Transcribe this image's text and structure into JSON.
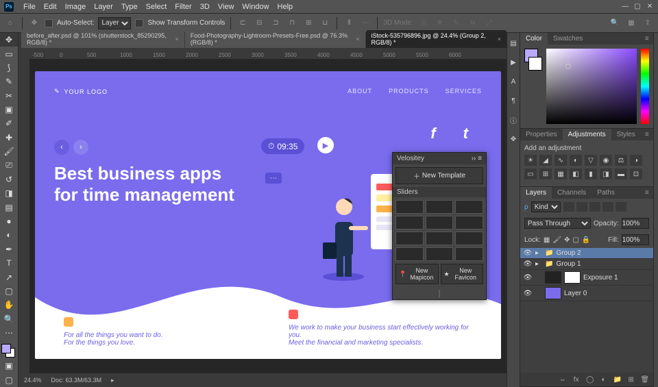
{
  "app": {
    "logo": "Ps"
  },
  "menu": [
    "File",
    "Edit",
    "Image",
    "Layer",
    "Type",
    "Select",
    "Filter",
    "3D",
    "View",
    "Window",
    "Help"
  ],
  "options": {
    "auto_select": "Auto-Select:",
    "auto_select_value": "Layer",
    "show_transform": "Show Transform Controls",
    "mode_label": "3D Mode:"
  },
  "tabs": [
    {
      "label": "before_after.psd @ 101% (shutterstock_85290295, RGB/8) *",
      "active": false
    },
    {
      "label": "Food-Photography-Lightroom-Presets-Free.psd @ 76.3% (RGB/8) *",
      "active": false
    },
    {
      "label": "iStock-535796896.jpg @ 24.4% (Group 2, RGB/8) *",
      "active": true
    }
  ],
  "ruler_marks": [
    "-500",
    "0",
    "500",
    "1000",
    "1500",
    "2000",
    "2500",
    "3000",
    "3500",
    "4000",
    "4500",
    "5000",
    "5500",
    "6000"
  ],
  "artboard": {
    "logo_text": "YOUR LOGO",
    "nav": [
      "ABOUT",
      "PRODUCTS",
      "SERVICES"
    ],
    "title_line1": "Best business apps",
    "title_line2": "for time management",
    "timer": "09:35",
    "left_line1": "For all the things you want to do.",
    "left_line2": "For the things you love.",
    "right_line1": "We work to make your business start effectively working for you.",
    "right_line2": "Meet the financial and marketing specialists.",
    "social_f": "f",
    "social_t": "t"
  },
  "velositey": {
    "title": "Velositey",
    "new_template": "New Template",
    "sliders": "Sliders",
    "new_mapicon": "New Mapicon",
    "new_favicon": "New Favicon"
  },
  "panels": {
    "color_tabs": [
      "Color",
      "Swatches"
    ],
    "adj_tabs": [
      "Properties",
      "Adjustments",
      "Styles"
    ],
    "adj_label": "Add an adjustment",
    "layer_tabs": [
      "Layers",
      "Channels",
      "Paths"
    ],
    "kind": "Kind",
    "blend": "Pass Through",
    "opacity_label": "Opacity:",
    "opacity": "100%",
    "lock_label": "Lock:",
    "fill_label": "Fill:",
    "fill": "100%"
  },
  "layers": [
    {
      "name": "Group 2",
      "folder": true,
      "selected": true
    },
    {
      "name": "Group 1",
      "folder": true,
      "selected": false
    },
    {
      "name": "Exposure 1",
      "folder": false,
      "selected": false
    },
    {
      "name": "Layer 0",
      "folder": false,
      "selected": false
    }
  ],
  "status": {
    "zoom": "24.4%",
    "doc": "Doc: 63.3M/63.3M"
  },
  "colors": {
    "fg": "#b9a9ff",
    "bg": "#ffffff",
    "accent": "#7a6ced"
  }
}
